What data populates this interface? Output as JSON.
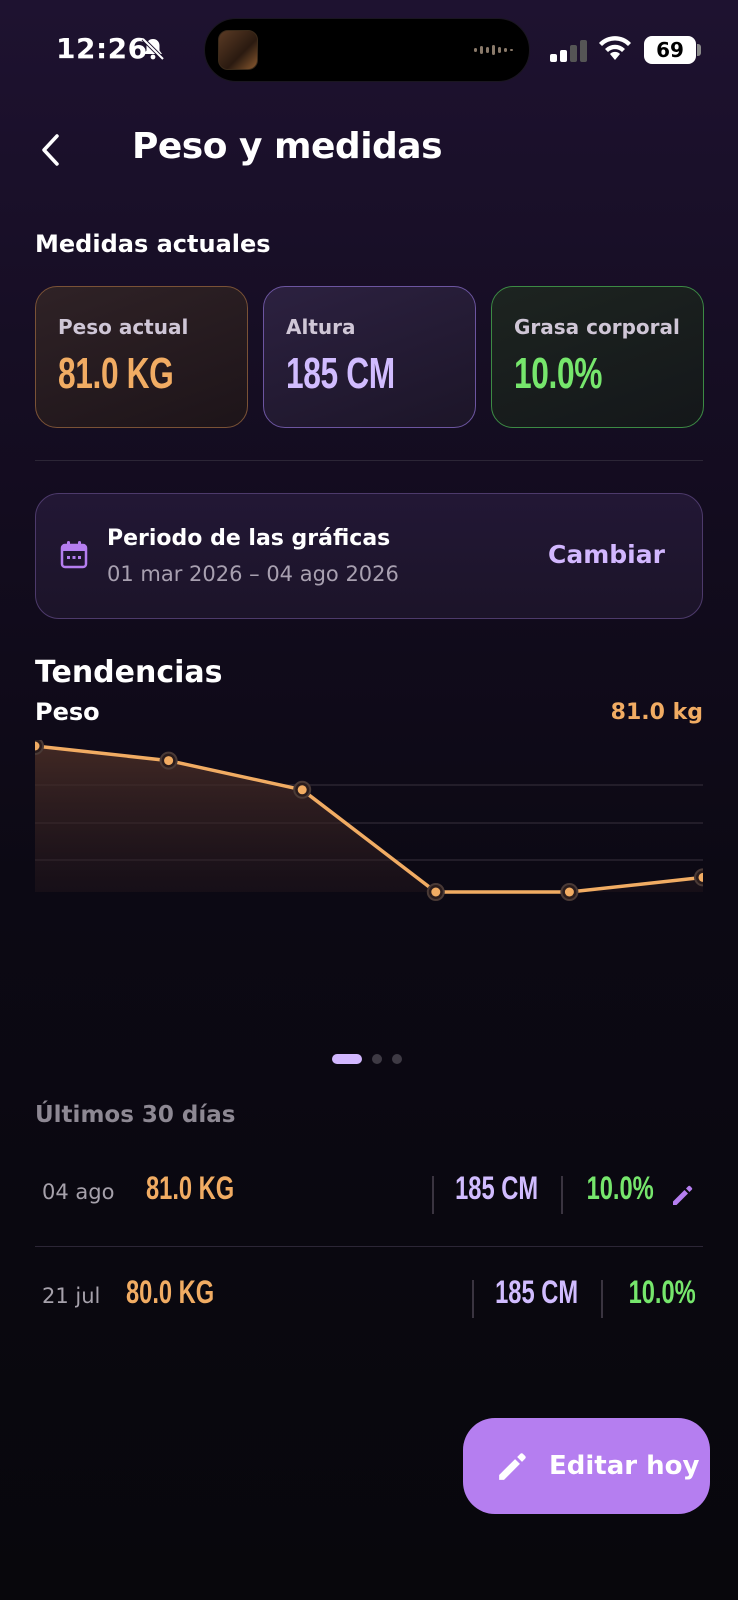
{
  "status": {
    "time": "12:26",
    "battery": "69"
  },
  "header": {
    "title": "Peso y medidas"
  },
  "current": {
    "section_label": "Medidas actuales",
    "weight": {
      "label": "Peso actual",
      "value": "81.0 KG"
    },
    "height": {
      "label": "Altura",
      "value": "185 CM"
    },
    "fat": {
      "label": "Grasa corporal",
      "value": "10.0%"
    }
  },
  "period": {
    "title": "Periodo de las gráficas",
    "range": "01 mar 2026 – 04 ago 2026",
    "change_label": "Cambiar"
  },
  "trends": {
    "section_label": "Tendencias",
    "chart_title": "Peso",
    "current_value": "81.0 kg"
  },
  "chart_data": {
    "type": "area",
    "title": "Peso",
    "xlabel": "",
    "ylabel": "",
    "x": [
      1,
      2,
      3,
      4,
      5,
      6
    ],
    "series": [
      {
        "values": [
          81.0,
          80.8,
          80.4,
          79.0,
          79.0,
          79.2
        ]
      }
    ],
    "ylim": [
      79.0,
      81.0
    ],
    "grid": true,
    "color": "#f1ac63",
    "pages": 3,
    "active_page": 1
  },
  "last_days": {
    "section_label": "Últimos 30 días",
    "entries": [
      {
        "date": "04 ago",
        "weight": "81.0 KG",
        "height": "185 CM",
        "fat": "10.0%",
        "editable": true
      },
      {
        "date": "21 jul",
        "weight": "80.0 KG",
        "height": "185 CM",
        "fat": "10.0%",
        "editable": false
      }
    ]
  },
  "fab": {
    "label": "Editar hoy"
  },
  "colors": {
    "accent": "#b57ef0",
    "weight": "#f1ac63",
    "height": "#d1bcff",
    "fat": "#76e66c"
  }
}
